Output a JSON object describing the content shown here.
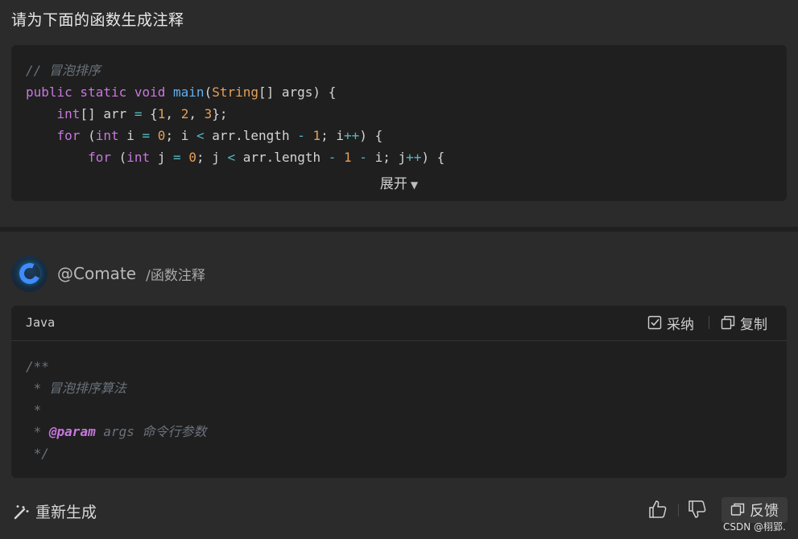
{
  "question": {
    "text": "请为下面的函数生成注释"
  },
  "source_code": {
    "lines": [
      [
        {
          "t": "// 冒泡排序",
          "c": "comment"
        }
      ],
      [
        {
          "t": "public static void ",
          "c": "kw"
        },
        {
          "t": "main",
          "c": "fn"
        },
        {
          "t": "(",
          "c": "plain"
        },
        {
          "t": "String",
          "c": "type"
        },
        {
          "t": "[] args) {",
          "c": "plain"
        }
      ],
      [
        {
          "t": "    ",
          "c": "plain"
        },
        {
          "t": "int",
          "c": "kw"
        },
        {
          "t": "[] arr ",
          "c": "plain"
        },
        {
          "t": "=",
          "c": "op"
        },
        {
          "t": " {",
          "c": "plain"
        },
        {
          "t": "1",
          "c": "num"
        },
        {
          "t": ", ",
          "c": "plain"
        },
        {
          "t": "2",
          "c": "num"
        },
        {
          "t": ", ",
          "c": "plain"
        },
        {
          "t": "3",
          "c": "num"
        },
        {
          "t": "};",
          "c": "plain"
        }
      ],
      [
        {
          "t": "    ",
          "c": "plain"
        },
        {
          "t": "for",
          "c": "kw"
        },
        {
          "t": " (",
          "c": "plain"
        },
        {
          "t": "int",
          "c": "kw"
        },
        {
          "t": " i ",
          "c": "plain"
        },
        {
          "t": "=",
          "c": "op"
        },
        {
          "t": " ",
          "c": "plain"
        },
        {
          "t": "0",
          "c": "num"
        },
        {
          "t": "; i ",
          "c": "plain"
        },
        {
          "t": "<",
          "c": "op"
        },
        {
          "t": " arr.length ",
          "c": "plain"
        },
        {
          "t": "-",
          "c": "op"
        },
        {
          "t": " ",
          "c": "plain"
        },
        {
          "t": "1",
          "c": "num"
        },
        {
          "t": "; i",
          "c": "plain"
        },
        {
          "t": "++",
          "c": "op"
        },
        {
          "t": ") {",
          "c": "plain"
        }
      ],
      [
        {
          "t": "        ",
          "c": "plain"
        },
        {
          "t": "for",
          "c": "kw"
        },
        {
          "t": " (",
          "c": "plain"
        },
        {
          "t": "int",
          "c": "kw"
        },
        {
          "t": " j ",
          "c": "plain"
        },
        {
          "t": "=",
          "c": "op"
        },
        {
          "t": " ",
          "c": "plain"
        },
        {
          "t": "0",
          "c": "num"
        },
        {
          "t": "; j ",
          "c": "plain"
        },
        {
          "t": "<",
          "c": "op"
        },
        {
          "t": " arr.length ",
          "c": "plain"
        },
        {
          "t": "-",
          "c": "op"
        },
        {
          "t": " ",
          "c": "plain"
        },
        {
          "t": "1",
          "c": "num"
        },
        {
          "t": " ",
          "c": "plain"
        },
        {
          "t": "-",
          "c": "op"
        },
        {
          "t": " i; j",
          "c": "plain"
        },
        {
          "t": "++",
          "c": "op"
        },
        {
          "t": ") {",
          "c": "plain"
        }
      ]
    ],
    "expand_label": "展开",
    "expand_icon": "caret-down-icon"
  },
  "answer": {
    "bot_name": "@Comate",
    "command": "/函数注释",
    "avatar_icon": "comate-logo-icon",
    "language": "Java",
    "adopt_label": "采纳",
    "copy_label": "复制",
    "code_lines": [
      [
        {
          "t": "/**",
          "c": "comment"
        }
      ],
      [
        {
          "t": " * 冒泡排序算法",
          "c": "comment"
        }
      ],
      [
        {
          "t": " *",
          "c": "comment"
        }
      ],
      [
        {
          "t": " * ",
          "c": "comment"
        },
        {
          "t": "@param",
          "c": "tag"
        },
        {
          "t": " args 命令行参数",
          "c": "comment"
        }
      ],
      [
        {
          "t": " */",
          "c": "comment"
        }
      ]
    ]
  },
  "footer": {
    "regenerate_label": "重新生成",
    "feedback_label": "反馈",
    "watermark": "CSDN @栩郢."
  },
  "colors": {
    "background": "#2b2b2b",
    "card": "#1f1f1f",
    "keyword": "#c678dd",
    "function": "#61afef",
    "number": "#e5a05a",
    "operator": "#56b6c2",
    "comment": "#6a737d"
  }
}
